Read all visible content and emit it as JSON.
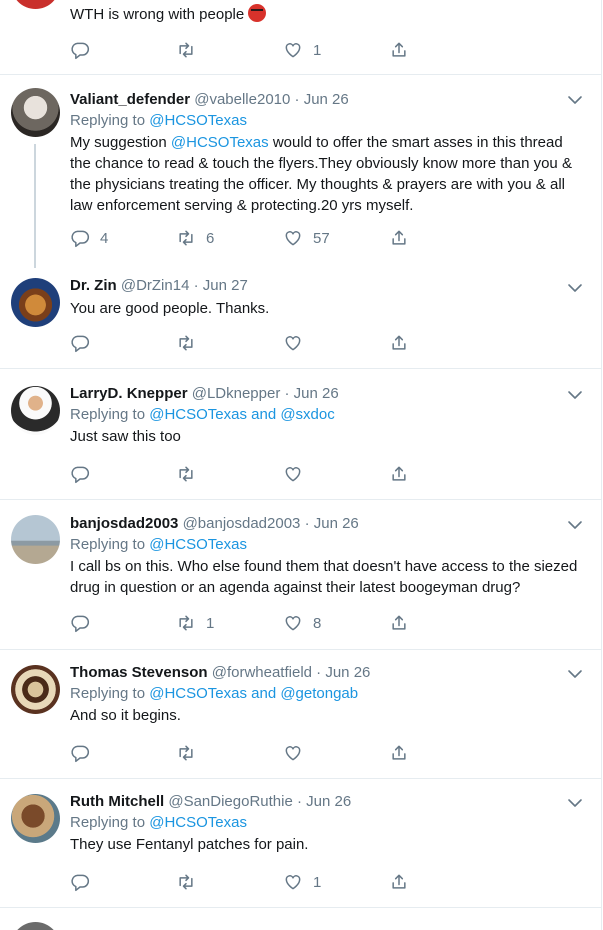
{
  "tweets": [
    {
      "text": "WTH is wrong with people",
      "actions": {
        "replies": "",
        "retweets": "",
        "likes": "1"
      }
    },
    {
      "name": "Valiant_defender",
      "handle": "@vabelle2010",
      "date": "Jun 26",
      "replying_prefix": "Replying to",
      "replying_to": "@HCSOTexas",
      "replying_rest": "",
      "text_pre": "My suggestion",
      "text_mention": "@HCSOTexas",
      "text_post": "would to offer the smart asses in this thread the chance to read & touch the flyers.They obviously know more than you & the physicians treating the officer. My thoughts & prayers are with you & all law enforcement serving & protecting.20 yrs myself.",
      "actions": {
        "replies": "4",
        "retweets": "6",
        "likes": "57"
      }
    },
    {
      "name": "Dr. Zin",
      "handle": "@DrZin14",
      "date": "Jun 27",
      "text": "You are good people. Thanks.",
      "actions": {
        "replies": "",
        "retweets": "",
        "likes": ""
      }
    },
    {
      "name": "LarryD. Knepper",
      "handle": "@LDknepper",
      "date": "Jun 26",
      "replying_prefix": "Replying to",
      "replying_to": "@HCSOTexas and @sxdoc",
      "text": "Just saw this too",
      "actions": {
        "replies": "",
        "retweets": "",
        "likes": ""
      }
    },
    {
      "name": "banjosdad2003",
      "handle": "@banjosdad2003",
      "date": "Jun 26",
      "replying_prefix": "Replying to",
      "replying_to": "@HCSOTexas",
      "text": "I call bs on this. Who else found them that doesn't have access to the siezed drug in question or an agenda against their latest boogeyman drug?",
      "actions": {
        "replies": "",
        "retweets": "1",
        "likes": "8"
      }
    },
    {
      "name": "Thomas Stevenson",
      "handle": "@forwheatfield",
      "date": "Jun 26",
      "replying_prefix": "Replying to",
      "replying_to": "@HCSOTexas and @getongab",
      "text": "And so it begins.",
      "actions": {
        "replies": "",
        "retweets": "",
        "likes": ""
      }
    },
    {
      "name": "Ruth Mitchell",
      "handle": "@SanDiegoRuthie",
      "date": "Jun 26",
      "replying_prefix": "Replying to",
      "replying_to": "@HCSOTexas",
      "text": "They use Fentanyl patches for pain.",
      "actions": {
        "replies": "",
        "retweets": "",
        "likes": "1"
      }
    }
  ],
  "separator": "·",
  "colors": {
    "link": "#1b95e0",
    "muted": "#657786",
    "border": "#e6ecf0"
  }
}
